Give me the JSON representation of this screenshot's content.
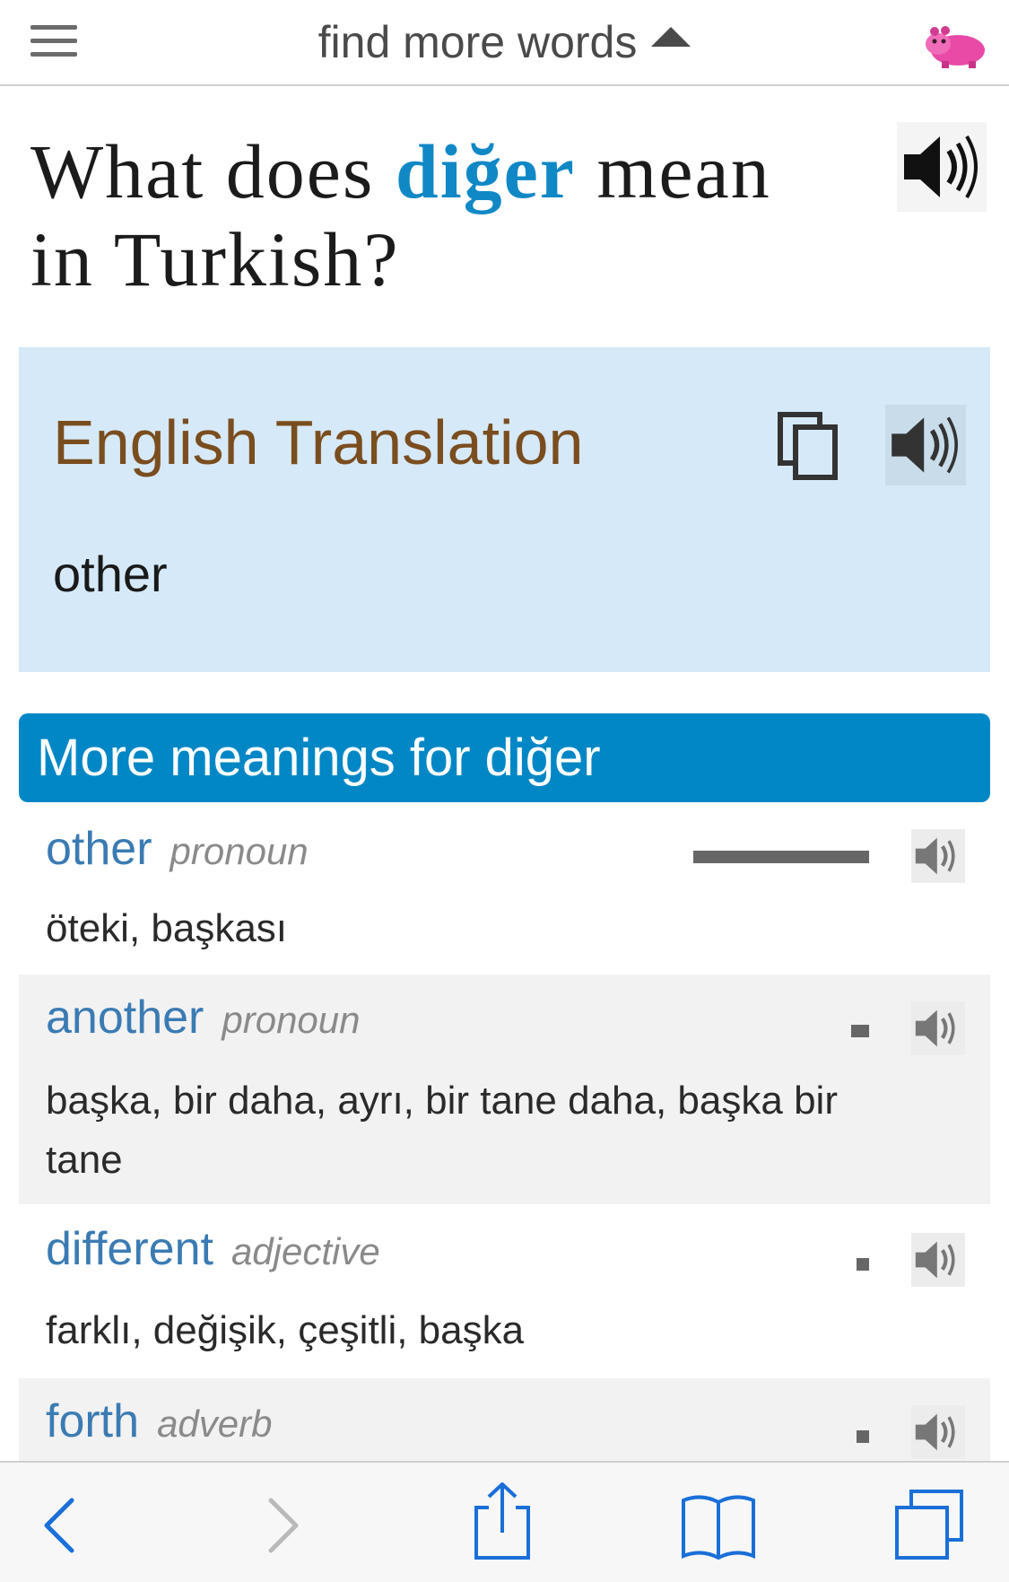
{
  "topbar": {
    "menu_icon": "hamburger-icon",
    "find_more_label": "find more words",
    "caret_icon": "caret-up-icon",
    "logo_icon": "hippo-logo-icon"
  },
  "title": {
    "prefix": "What does",
    "word": "diğer",
    "suffix_line1": "mean",
    "suffix_line2": "in Turkish?",
    "speaker_icon": "speaker-icon"
  },
  "translation": {
    "heading": "English Translation",
    "text": "other",
    "copy_icon": "copy-icon",
    "speaker_icon": "speaker-icon"
  },
  "more_meanings": {
    "header": "More meanings for diğer",
    "items": [
      {
        "word": "other",
        "pos": "pronoun",
        "defs": "öteki, başkası",
        "frequency": "high"
      },
      {
        "word": "another",
        "pos": "pronoun",
        "defs": "başka, bir daha, ayrı, bir tane daha, başka bir tane",
        "frequency": "low"
      },
      {
        "word": "different",
        "pos": "adjective",
        "defs": "farklı, değişik, çeşitli, başka",
        "frequency": "low"
      },
      {
        "word": "forth",
        "pos": "adverb",
        "defs": "",
        "frequency": "low"
      }
    ]
  },
  "bottombar": {
    "icons": [
      "back-icon",
      "forward-icon",
      "share-icon",
      "bookmarks-icon",
      "tabs-icon"
    ]
  },
  "colors": {
    "accent": "#0187c5",
    "word_link": "#3b7bb3",
    "translation_bg": "#d6e9f8",
    "heading_brown": "#7a4d1f",
    "ios_blue": "#1a6fd8"
  }
}
